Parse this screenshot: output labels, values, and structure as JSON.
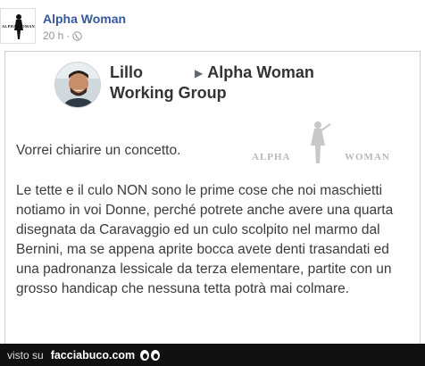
{
  "post": {
    "page_name": "Alpha Woman",
    "time": "20 h",
    "separator": "·",
    "avatar_text": "ALPHA WOMAN",
    "privacy_icon": "globe-icon"
  },
  "card": {
    "author_name": "Lillo",
    "arrow": "▶",
    "target_group_line1": "Alpha Woman",
    "target_group_line2": "Working Group",
    "watermark_left": "ALPHA",
    "watermark_right": "WOMAN",
    "intro": "Vorrei chiarire un concetto.",
    "body": "Le tette e il culo NON sono le prime cose che noi maschietti notiamo in voi Donne, perché potrete anche avere una quarta disegnata da Caravaggio ed un culo scolpito nel marmo dal Bernini, ma se appena aprite bocca avete denti trasandati ed una padronanza lessicale da terza elementare, partite con un grosso handicap che nessuna tetta potrà mai colmare."
  },
  "footer": {
    "visto_label": "visto su",
    "site": "facciabuco.com",
    "icon": "eyes-icon"
  }
}
